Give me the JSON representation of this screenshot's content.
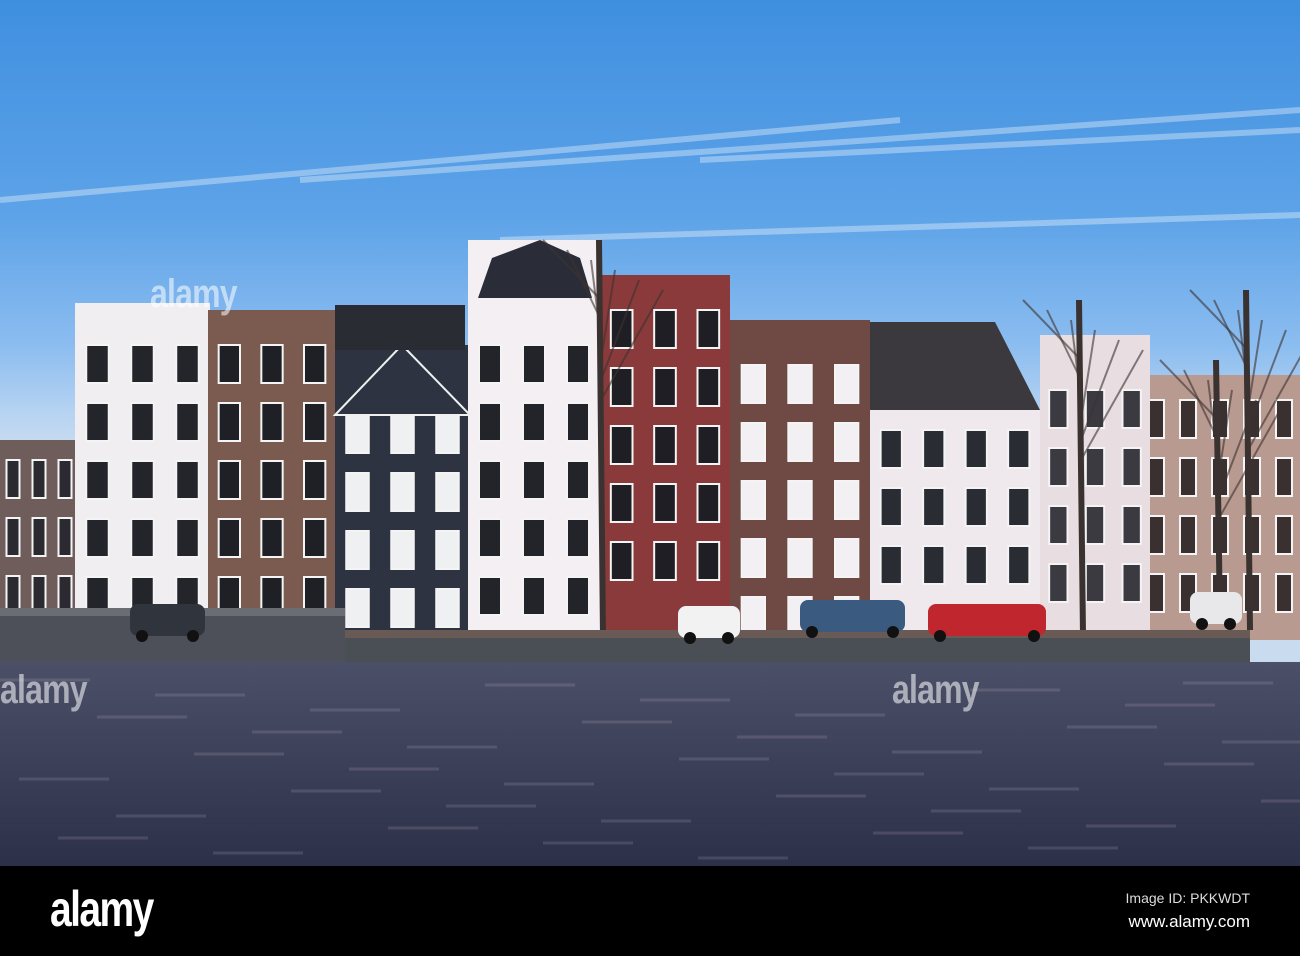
{
  "photo": {
    "watermark_text": "alamy",
    "colors": {
      "sky_top": "#3f8fe0",
      "water": "#343a52",
      "quay": "#4a4f55"
    }
  },
  "footer": {
    "logo": "alamy",
    "image_id": "Image ID: PKKWDT",
    "website": "www.alamy.com"
  }
}
